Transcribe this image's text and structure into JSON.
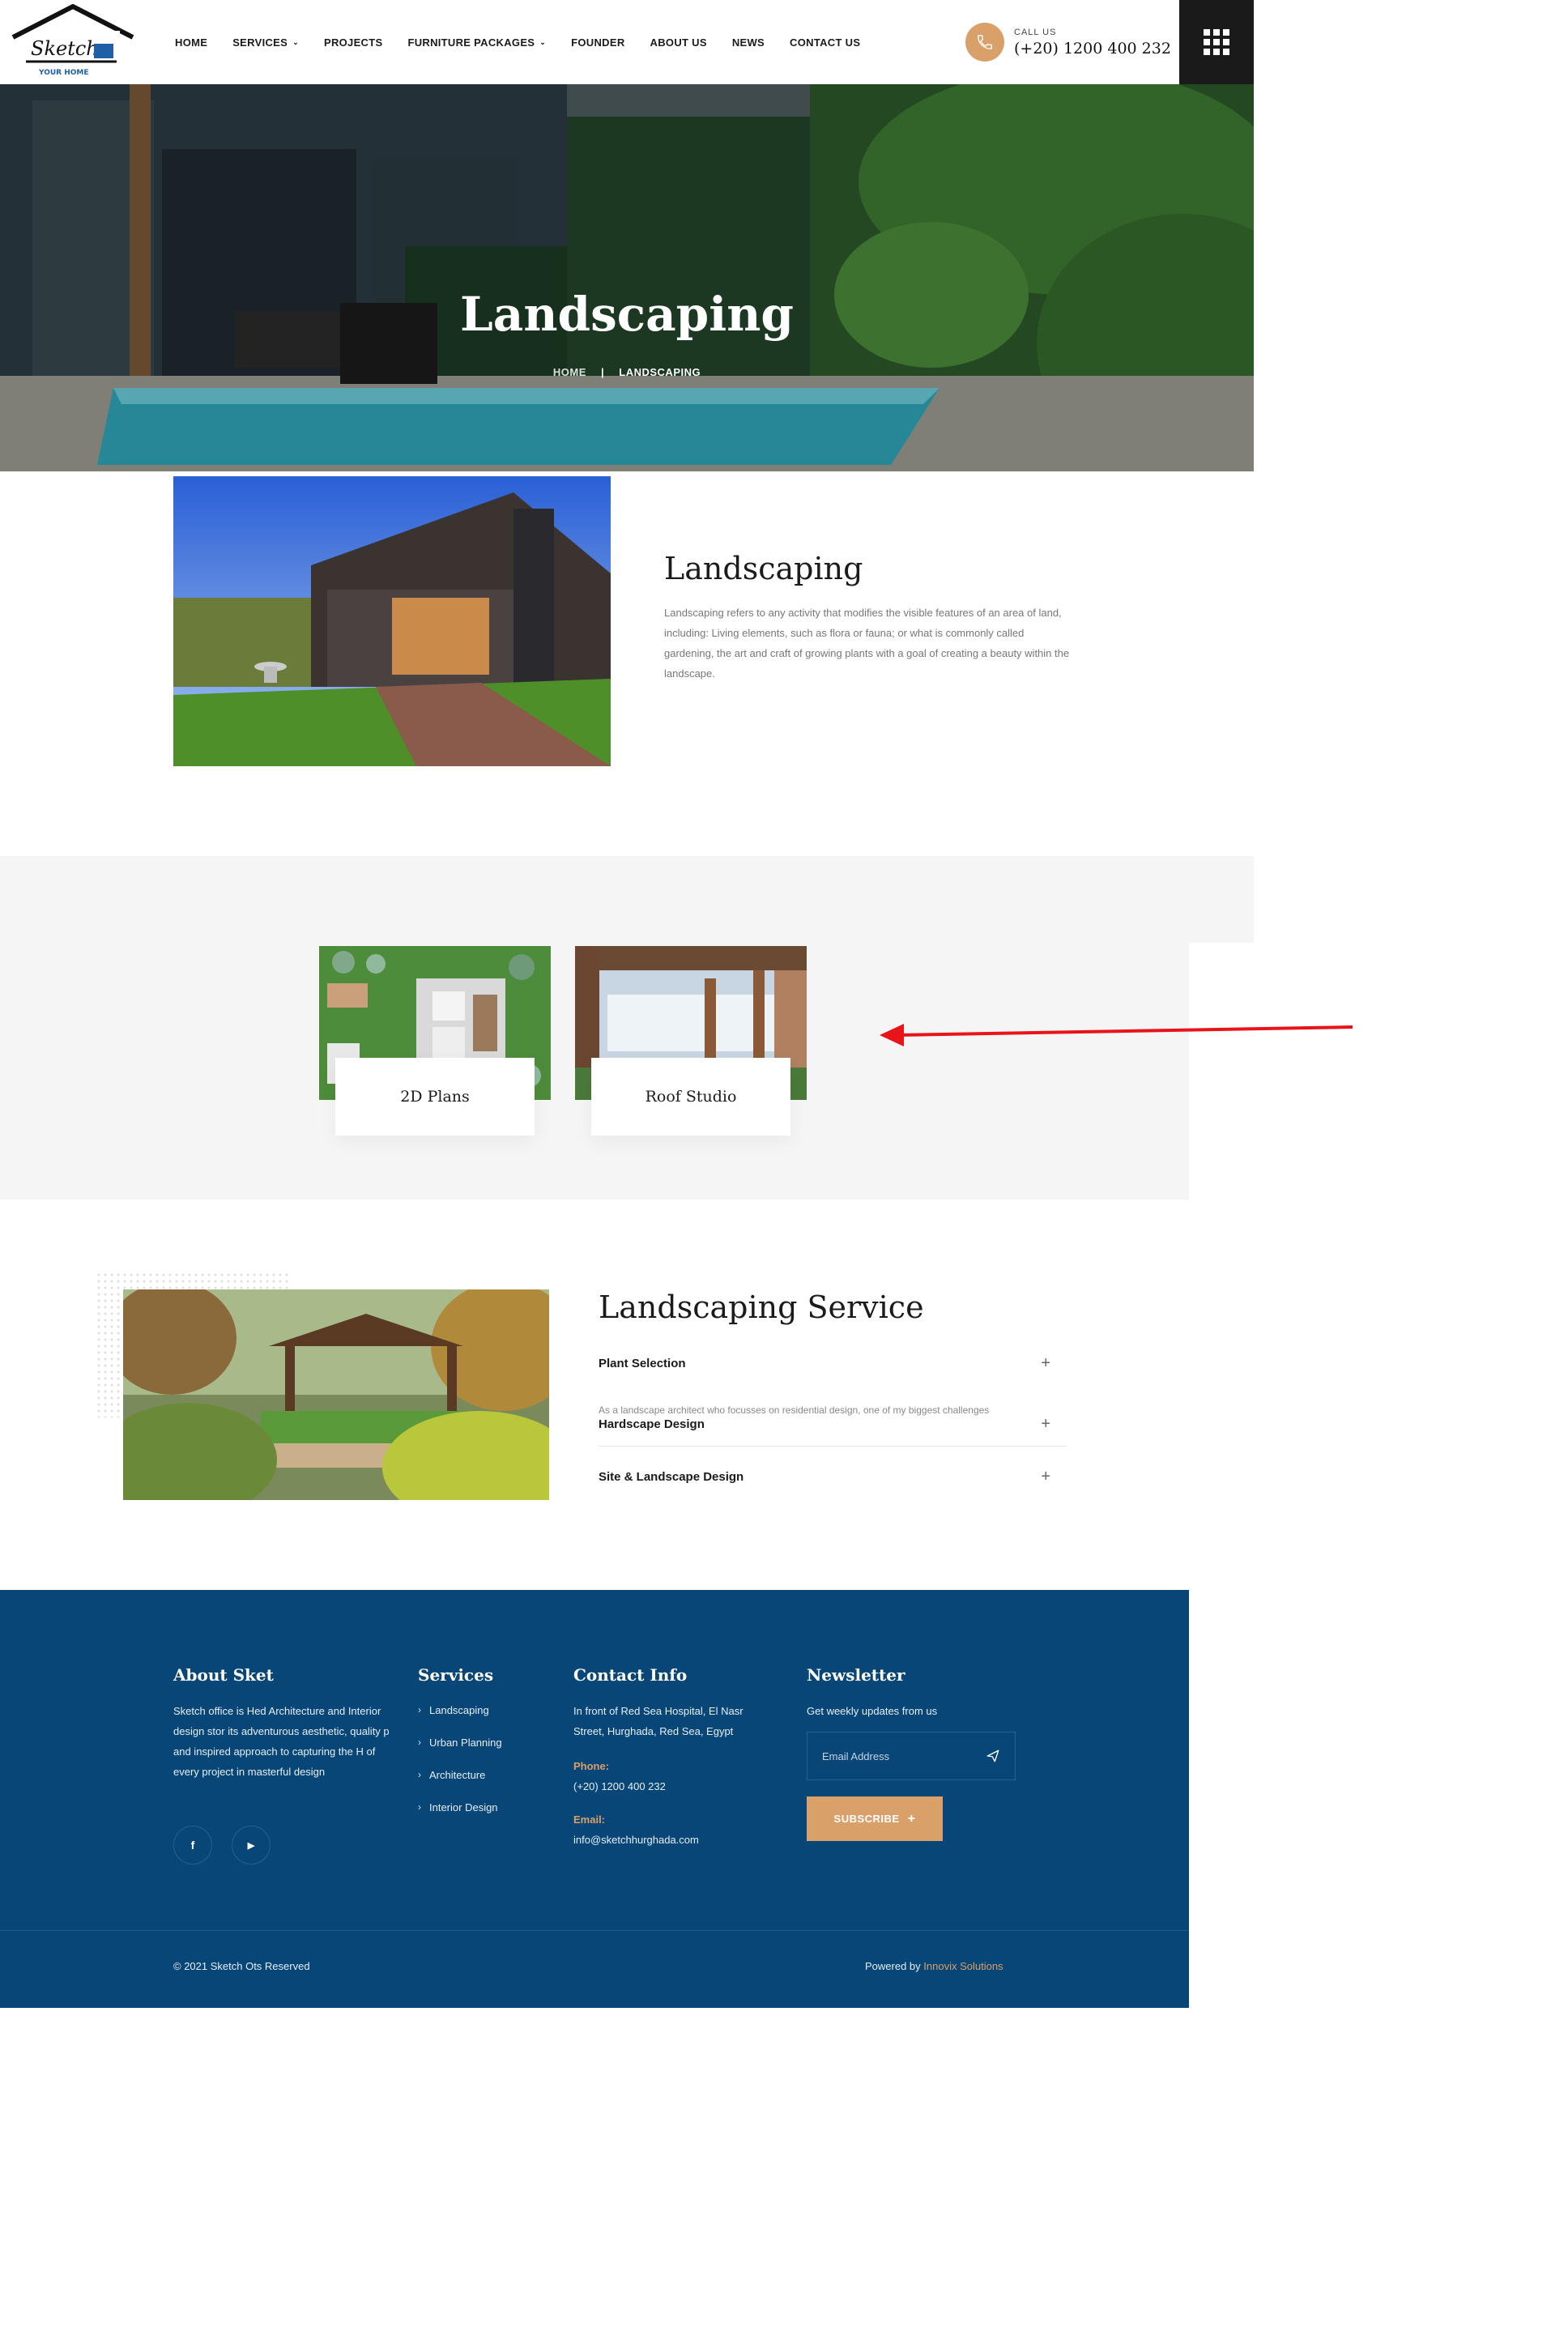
{
  "header": {
    "logo_text": "Sketch",
    "logo_tagline": "YOUR HOME",
    "nav": [
      {
        "label": "HOME",
        "dropdown": false
      },
      {
        "label": "SERVICES",
        "dropdown": true
      },
      {
        "label": "PROJECTS",
        "dropdown": false
      },
      {
        "label": "FURNITURE PACKAGES",
        "dropdown": true
      },
      {
        "label": "FOUNDER",
        "dropdown": false
      },
      {
        "label": "ABOUT US",
        "dropdown": false
      },
      {
        "label": "NEWS",
        "dropdown": false
      },
      {
        "label": "CONTACT US",
        "dropdown": false
      }
    ],
    "call_label": "CALL US",
    "call_number": "(+20) 1200 400 232",
    "menu_icon": "grid-icon"
  },
  "hero": {
    "title": "Landscaping",
    "breadcrumb": {
      "home": "HOME",
      "separator": "|",
      "current": "LANDSCAPING"
    }
  },
  "intro": {
    "title": "Landscaping",
    "text": "Landscaping refers to any activity that modifies the visible features of an area of land, including: Living elements, such as flora or fauna; or what is commonly called gardening, the art and craft of growing plants with a goal of creating a beauty within the landscape."
  },
  "projects": [
    {
      "label": "2D Plans"
    },
    {
      "label": "Roof Studio"
    }
  ],
  "service": {
    "title": "Landscaping Service",
    "items": [
      {
        "title": "Plant Selection",
        "body": "As a landscape architect who focusses on residential design, one of my biggest challenges",
        "icon": "plus-icon"
      },
      {
        "title": "Hardscape Design",
        "icon": "plus-icon"
      },
      {
        "title": "Site & Landscape Design",
        "icon": "plus-icon"
      }
    ]
  },
  "footer": {
    "about": {
      "title": "About Sket",
      "text": "Sketch office is Hed Architecture and Interior design stor its adventurous aesthetic, quality p and inspired approach to capturing the H of every project in masterful design",
      "social": [
        "f",
        "▶"
      ]
    },
    "services": {
      "title": "Services",
      "items": [
        "Landscaping",
        "Urban Planning",
        "Architecture",
        "Interior Design"
      ]
    },
    "contact": {
      "title": "Contact Info",
      "address": "In front of Red Sea Hospital, El Nasr Street, Hurghada, Red Sea, Egypt",
      "phone_label": "Phone:",
      "phone": "(+20) 1200 400 232",
      "email_label": "Email:",
      "email": "info@sketchhurghada.com"
    },
    "newsletter": {
      "title": "Newsletter",
      "text": "Get weekly updates from us",
      "placeholder": "Email Address",
      "button": "SUBSCRIBE",
      "button_icon": "+"
    },
    "copyright": "© 2021 Sketch Ots Reserved",
    "powered_prefix": "Powered by",
    "powered_by": "Innovix Solutions"
  },
  "colors": {
    "accent": "#d9a06a",
    "footer_bg": "#084677",
    "band_bg": "#f5f5f5",
    "arrow": "#e8141a"
  }
}
